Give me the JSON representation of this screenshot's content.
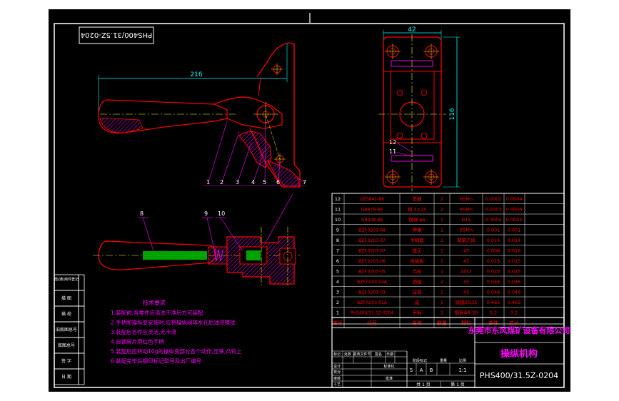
{
  "title_block": {
    "drawing_number": "PHS400/31.5Z-0204",
    "company": "东莞市东风煤矿设备有限公司",
    "part_name": "操纵机构",
    "scale": "1:1",
    "sheet_total": "共 1 页",
    "sheet_current": "第 1 页",
    "stage_marks": [
      "S",
      "A",
      "B"
    ],
    "stage_label": "阶段标记",
    "weight_label": "重量",
    "scale_label": "比例",
    "revision_headers": [
      "标记",
      "处数",
      "更改文件号",
      "签名",
      "日期"
    ],
    "sign_rows": [
      "设计",
      "校对",
      "审核",
      "工艺"
    ],
    "sign_col2": [
      "标准化",
      "",
      "批准",
      ""
    ]
  },
  "dimensions": {
    "length_216": "216",
    "width_42": "42",
    "height_116": "116"
  },
  "balloons_top": [
    "1",
    "2",
    "3",
    "4",
    "5",
    "6",
    "7"
  ],
  "balloons_bottom": [
    "8",
    "9",
    "10"
  ],
  "balloons_side": [
    "12",
    "11"
  ],
  "left_margin": [
    "借(通)用件登记",
    "描 图",
    "描 校",
    "旧底图总号",
    "底图总号",
    "签 字",
    "日 期"
  ],
  "tech_notes": {
    "title": "技术要求",
    "items": [
      "1.装配前,各零件应清洗干净后方可装配",
      "2.手柄和操纵变安装时,应将操纵阀体水孔后油浸擦拭",
      "3.装配后各件应灵活,无卡滞",
      "4.自锁阀片用红色手柄",
      "5.装配后应转动10g的操纵变部分各个动作,压铁,凸轮上",
      "6.装配完毕后钢印标记型号及出厂编号"
    ]
  },
  "bom": {
    "header": [
      "序号",
      "代号",
      "名称",
      "数量",
      "材料",
      "单件",
      "总计"
    ],
    "rows": [
      [
        "12",
        "GB5841-86",
        "垫圈",
        "2",
        "65Mn",
        "0.0002",
        "0.0004"
      ],
      [
        "11",
        "GB879-86",
        "销 4×25",
        "2",
        "65Mn",
        "0.0003",
        "0.0006"
      ],
      [
        "10",
        "GB308-89",
        "钢球 φ6",
        "1",
        "G15",
        "0.0004",
        "0.0004"
      ],
      [
        "9",
        "BZF.0203-08",
        "弹簧",
        "1",
        "65Mn",
        "0.001",
        "0.001"
      ],
      [
        "8",
        "BZF.0203-07",
        "手柄套",
        "1",
        "聚氯乙烯",
        "0.014",
        "0.014"
      ],
      [
        "7",
        "BZF.0203-07",
        "拨叉",
        "1",
        "45",
        "0.008",
        "0.016"
      ],
      [
        "6",
        "BZF.0203-06",
        "连接板",
        "1",
        "45",
        "0.015",
        "0.015"
      ],
      [
        "5",
        "BZF.0203-05",
        "凸轮",
        "1",
        "40Cr",
        "0.025",
        "0.025"
      ],
      [
        "4",
        "BZF.0203-04A",
        "销轴",
        "2",
        "45",
        "0.046",
        "0.046"
      ],
      [
        "3",
        "BZF.0203-03",
        "压铁",
        "1",
        "45",
        "0.046",
        "0.046"
      ],
      [
        "2",
        "BZF.0203-01A",
        "座",
        "1",
        "铸钢ZG35",
        "0.465",
        "0.465"
      ],
      [
        "1",
        "PHS400/31.5Z-0204",
        "手柄",
        "1",
        "钢管Φ8-30",
        "0.2",
        "0.2"
      ]
    ]
  },
  "colors": {
    "background": "#000000",
    "frame": "#ffffff",
    "outline": "#ff0000",
    "center": "#ffff00",
    "leader": "#ff00ff",
    "dimension": "#00ffff",
    "hatch": "#ff00ff",
    "table": "#ffffff",
    "table_text": "#ff0000",
    "fill": "#00ff00"
  }
}
